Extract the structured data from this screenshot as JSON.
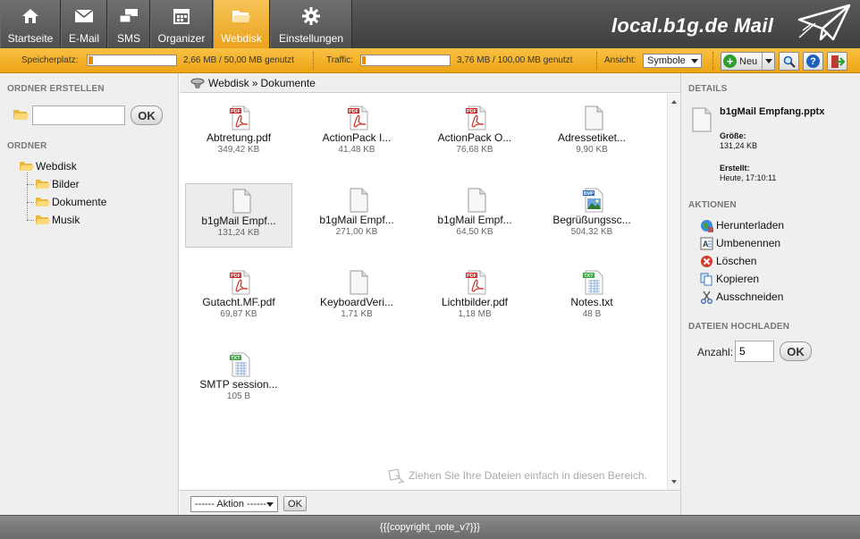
{
  "brand": {
    "title": "local.b1g.de Mail"
  },
  "nav": [
    {
      "label": "Startseite",
      "icon": "home-icon",
      "active": false
    },
    {
      "label": "E-Mail",
      "icon": "envelope-icon",
      "active": false
    },
    {
      "label": "SMS",
      "icon": "sms-icon",
      "active": false
    },
    {
      "label": "Organizer",
      "icon": "calendar-icon",
      "active": false
    },
    {
      "label": "Webdisk",
      "icon": "folder-icon",
      "active": true
    },
    {
      "label": "Einstellungen",
      "icon": "gear-icon",
      "active": false
    }
  ],
  "statusbar": {
    "storage_label": "Speicherplatz:",
    "storage_value": "2,66 MB / 50,00 MB genutzt",
    "storage_fraction": 0.053,
    "traffic_label": "Traffic:",
    "traffic_value": "3,76 MB / 100,00 MB genutzt",
    "traffic_fraction": 0.038,
    "view_label": "Ansicht:",
    "view_value": "Symbole",
    "new_label": "Neu"
  },
  "left": {
    "create_heading": "ORDNER ERSTELLEN",
    "create_ok": "OK",
    "folders_heading": "ORDNER",
    "tree": {
      "root": "Webdisk",
      "children": [
        "Bilder",
        "Dokumente",
        "Musik"
      ]
    }
  },
  "center": {
    "breadcrumb_root": "Webdisk",
    "breadcrumb_sep": "»",
    "breadcrumb_current": "Dokumente",
    "files": [
      {
        "name": "Abtretung.pdf",
        "size": "349,42 KB",
        "type": "pdf"
      },
      {
        "name": "ActionPack I...",
        "size": "41,48 KB",
        "type": "pdf"
      },
      {
        "name": "ActionPack O...",
        "size": "76,68 KB",
        "type": "pdf"
      },
      {
        "name": "Adressetiket...",
        "size": "9,90 KB",
        "type": "doc"
      },
      {
        "name": "b1gMail Empf...",
        "size": "131,24 KB",
        "type": "doc",
        "selected": true
      },
      {
        "name": "b1gMail Empf...",
        "size": "271,00 KB",
        "type": "doc"
      },
      {
        "name": "b1gMail Empf...",
        "size": "64,50 KB",
        "type": "doc"
      },
      {
        "name": "Begrüßungssc...",
        "size": "504,32 KB",
        "type": "bmp"
      },
      {
        "name": "Gutacht.MF.pdf",
        "size": "69,87 KB",
        "type": "pdf"
      },
      {
        "name": "KeyboardVeri...",
        "size": "1,71 KB",
        "type": "doc"
      },
      {
        "name": "Lichtbilder.pdf",
        "size": "1,18 MB",
        "type": "pdf"
      },
      {
        "name": "Notes.txt",
        "size": "48 B",
        "type": "txt"
      },
      {
        "name": "SMTP session...",
        "size": "105 B",
        "type": "txt"
      }
    ],
    "drop_hint": "Ziehen Sie Ihre Dateien einfach in diesen Bereich.",
    "action_select": "------ Aktion ------",
    "action_ok": "OK"
  },
  "right": {
    "details_heading": "DETAILS",
    "file_name": "b1gMail Empfang.pptx",
    "size_label": "Größe:",
    "size_value": "131,24 KB",
    "created_label": "Erstellt:",
    "created_value": "Heute, 17:10:11",
    "actions_heading": "AKTIONEN",
    "actions": [
      {
        "label": "Herunterladen",
        "icon": "download-globe-icon"
      },
      {
        "label": "Umbenennen",
        "icon": "rename-icon"
      },
      {
        "label": "Löschen",
        "icon": "delete-icon"
      },
      {
        "label": "Kopieren",
        "icon": "copy-icon"
      },
      {
        "label": "Ausschneiden",
        "icon": "scissors-icon"
      }
    ],
    "upload_heading": "DATEIEN HOCHLADEN",
    "upload_count_label": "Anzahl:",
    "upload_count_value": "5",
    "upload_ok": "OK"
  },
  "footer": {
    "text": "{{{copyright_note_v7}}}"
  },
  "colors": {
    "accent": "#f0aa20",
    "nav_bg": "#555555",
    "pdf_red": "#d0261c"
  }
}
